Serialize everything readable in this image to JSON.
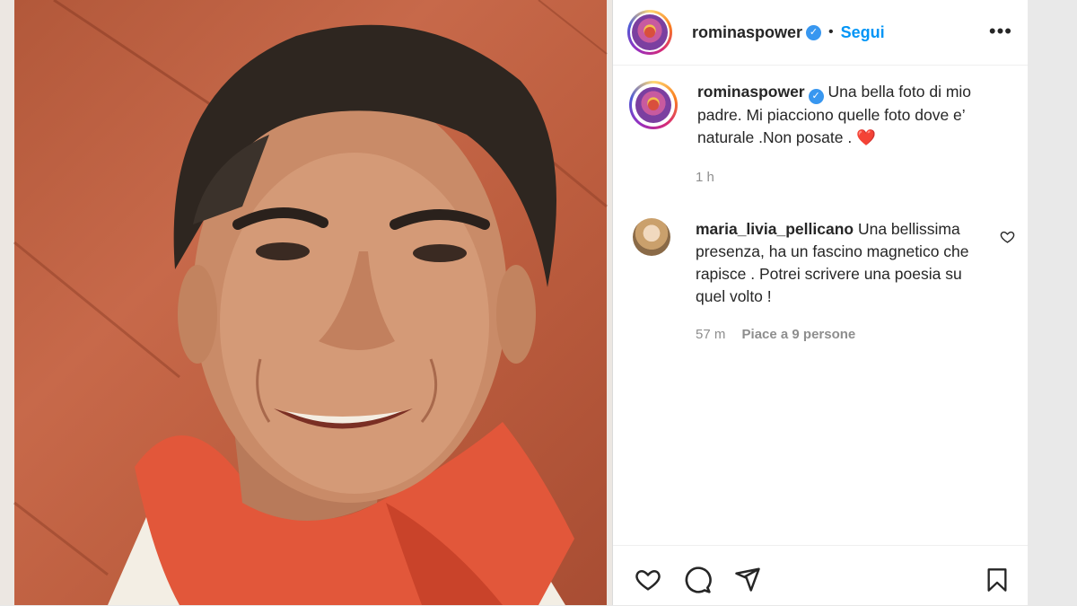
{
  "post": {
    "username": "rominaspower",
    "follow_label": "Segui",
    "more_label": "•••",
    "caption": "Una bella foto di mio padre. Mi piacciono quelle foto dove e’ naturale .Non posate . ❤️",
    "time": "1 h"
  },
  "comment": {
    "username": "maria_livia_pellicano",
    "text": "Una bellissima presenza, ha un fascino magnetico che rapisce . Potrei scrivere una poesia su quel volto !",
    "time": "57 m",
    "likes": "Piace a 9 persone"
  },
  "icons": {
    "verified": "verified-badge-icon",
    "like": "heart-icon",
    "comment": "comment-icon",
    "share": "share-icon",
    "save": "bookmark-icon"
  },
  "colors": {
    "accent": "#0095f6",
    "verified": "#3897f0",
    "muted": "#8e8e8e"
  }
}
